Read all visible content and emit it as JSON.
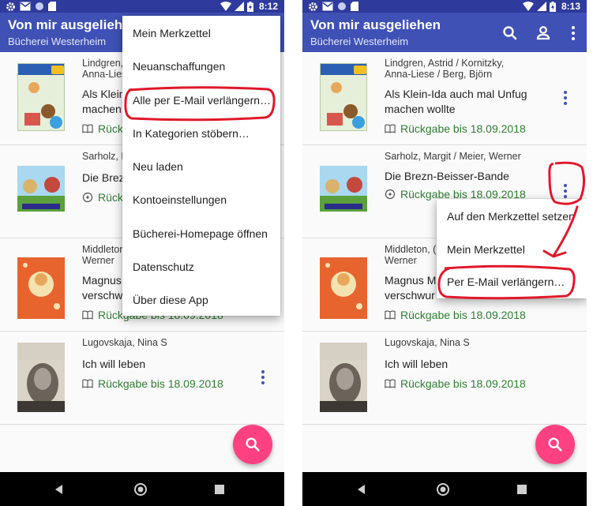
{
  "status_bar": {
    "time_left": "8:12",
    "time_right": "8:13"
  },
  "app_bar": {
    "title": "Von mir ausgeliehen",
    "subtitle": "Bücherei Westerheim"
  },
  "books": [
    {
      "authors_left": [
        "Lindgren,",
        "Anna-Liese"
      ],
      "authors_right": [
        "Lindgren, Astrid / Kornitzky,",
        "Anna-Liese / Berg, Björn"
      ],
      "title_left": [
        "Als Klein",
        "machen"
      ],
      "title_right": [
        "Als Klein-Ida auch mal Unfug",
        "machen wollte"
      ],
      "due_left": "Rückgabe",
      "due_right": "Rückgabe bis 18.09.2018",
      "cover": {
        "brand": "Büchersterne",
        "author": "Astrid Lindgren",
        "title": "Als Klein-Ida auch mal Unfug machen wollte"
      }
    },
    {
      "authors_left": [
        "Sarholz, M"
      ],
      "authors_right": [
        "Sarholz, Margit / Meier, Werner"
      ],
      "title_left": [
        "Die Brez"
      ],
      "title_right": [
        "Die Brezn-Beisser-Bande"
      ],
      "due_left": "Rückg",
      "due_right": "Rückgabe bis 18.09.2018"
    },
    {
      "authors_left": [
        "Middleton,",
        "Werner"
      ],
      "authors_right": [
        "Middleton, (",
        "Werner"
      ],
      "title_left": [
        "Magnus",
        "verschw"
      ],
      "title_right": [
        "Magnus M",
        "verschwur"
      ],
      "due_left": "Rückgabe bis 18.09.2018",
      "due_right": "Rückgabe bis 18.09.2018"
    },
    {
      "authors": [
        "Lugovskaja, Nina S"
      ],
      "title": [
        "Ich will leben"
      ],
      "due": "Rückgabe bis 18.09.2018",
      "cover": {
        "line1": "Nina Lugowskaja",
        "line2": "Ich will leben"
      }
    }
  ],
  "main_menu": {
    "items": [
      "Mein Merkzettel",
      "Neuanschaffungen",
      "Alle per E-Mail verlängern…",
      "In Kategorien stöbern…",
      "Neu laden",
      "Kontoeinstellungen",
      "Bücherei-Homepage öffnen",
      "Datenschutz",
      "Über diese App"
    ]
  },
  "item_menu": {
    "items": [
      "Auf den Merkzettel setzen",
      "Mein Merkzettel",
      "Per E-Mail verlängern…"
    ]
  },
  "icons": {
    "search": "search-icon",
    "account": "account-icon",
    "overflow": "more-vert-icon",
    "book": "book-icon",
    "disc": "disc-icon",
    "back": "back-icon",
    "home": "home-icon",
    "recents": "recents-icon"
  },
  "colors": {
    "status_bar": "#2e3a9c",
    "app_bar": "#3f51b5",
    "due_text": "#2e7d32",
    "fab": "#ff4081",
    "overflow_dots": "#3f51b5",
    "annotation": "#e0182a"
  }
}
